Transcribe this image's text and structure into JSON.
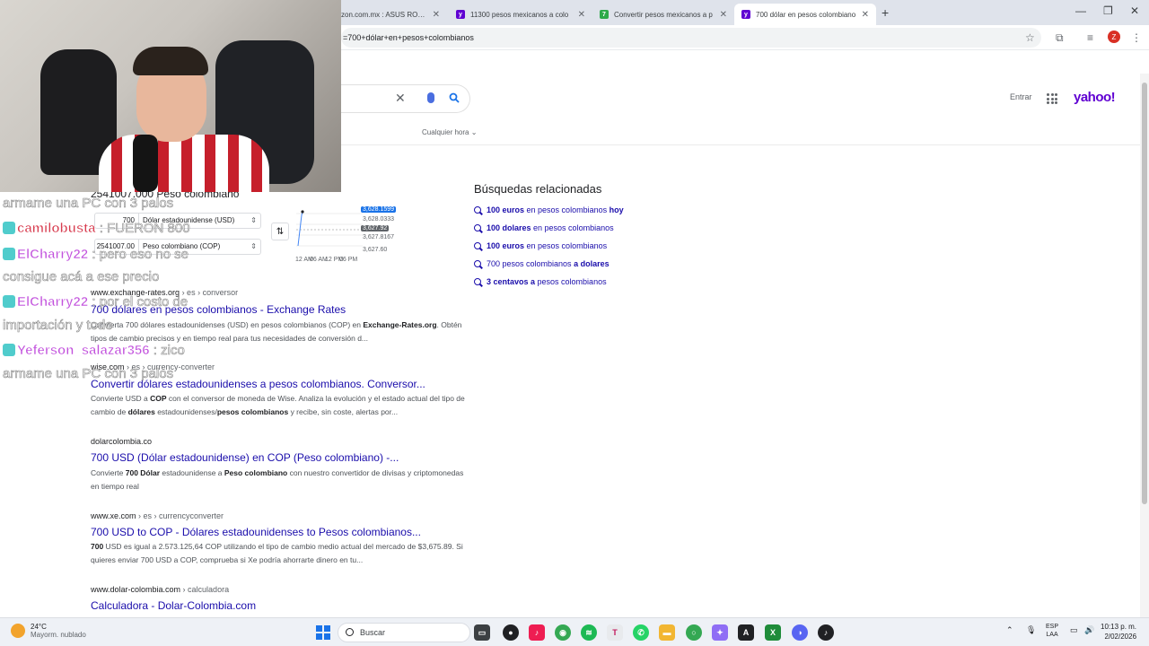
{
  "browser": {
    "tabs": [
      {
        "title": "zon.com.mx : ASUS ROG St",
        "favicon": "amazon-icon"
      },
      {
        "title": "11300 pesos mexicanos a colo",
        "favicon": "yahoo-icon"
      },
      {
        "title": "Convertir pesos mexicanos a p",
        "favicon": "green-icon"
      },
      {
        "title": "700 dólar en pesos colombiano",
        "favicon": "yahoo-icon"
      }
    ],
    "new_tab": "+",
    "address": "=700+dólar+en+pesos+colombianos",
    "profile_initial": "Z"
  },
  "page": {
    "entrar": "Entrar",
    "logo": "yahoo!",
    "filter": "Cualquier hora",
    "converter": {
      "result_title": "2541007.000 Peso colombiano",
      "from_amount": "700",
      "from_currency": "Dólar estadounidense (USD)",
      "to_amount": "2541007.00",
      "to_currency": "Peso colombiano (COP)",
      "chart_labels": [
        "3,628.1599",
        "3,628.0333",
        "3,627.92",
        "3,627.8167",
        "3,627.60"
      ],
      "x_labels": [
        "12 AM",
        "06 AM",
        "12 PM",
        "06 PM"
      ]
    },
    "results": [
      {
        "domain": "www.exchange-rates.org",
        "crumb": " › es › conversor",
        "title": "700 dólares en pesos colombianos - Exchange Rates",
        "snippet_parts": [
          {
            "t": "Convierta 700 dólares estadounidenses (USD) en pesos colombianos (COP) en ",
            "b": false
          },
          {
            "t": "Exchange-Rates.org",
            "b": true
          },
          {
            "t": ". Obtén tipos de cambio precisos y en tiempo real para tus necesidades de conversión d...",
            "b": false
          }
        ]
      },
      {
        "domain": "wise.com",
        "crumb": " › es › currency-converter",
        "title": "Convertir dólares estadounidenses a pesos colombianos. Conversor...",
        "snippet_parts": [
          {
            "t": "Convierte USD a ",
            "b": false
          },
          {
            "t": "COP",
            "b": true
          },
          {
            "t": " con el conversor de moneda de Wise. Analiza la evolución y el estado actual del tipo de cambio de ",
            "b": false
          },
          {
            "t": "dólares",
            "b": true
          },
          {
            "t": " estadounidenses/",
            "b": false
          },
          {
            "t": "pesos colombianos",
            "b": true
          },
          {
            "t": " y recibe, sin coste, alertas por...",
            "b": false
          }
        ]
      },
      {
        "domain": "dolarcolombia.co",
        "crumb": "",
        "title": "700 USD (Dólar estadounidense) en COP (Peso colombiano) -...",
        "snippet_parts": [
          {
            "t": "Convierte ",
            "b": false
          },
          {
            "t": "700 Dólar",
            "b": true
          },
          {
            "t": " estadounidense a ",
            "b": false
          },
          {
            "t": "Peso colombiano",
            "b": true
          },
          {
            "t": " con nuestro convertidor de divisas y criptomonedas en tiempo real",
            "b": false
          }
        ]
      },
      {
        "domain": "www.xe.com",
        "crumb": " › es › currencyconverter",
        "title": "700 USD to COP - Dólares estadounidenses to Pesos colombianos...",
        "snippet_parts": [
          {
            "t": "700",
            "b": true
          },
          {
            "t": " USD es igual a 2.573.125,64 COP utilizando el tipo de cambio medio actual del mercado de $3,675.89. Si quieres enviar 700 USD a COP, comprueba si Xe podría ahorrarte dinero en tu...",
            "b": false
          }
        ]
      },
      {
        "domain": "www.dolar-colombia.com",
        "crumb": " › calculadora",
        "title": "Calculadora - Dolar-Colombia.com",
        "snippet_parts": []
      }
    ],
    "related": {
      "heading": "Búsquedas relacionadas",
      "items": [
        {
          "pre": "100 euros",
          "mid": " en pesos colombianos ",
          "post": "hoy"
        },
        {
          "pre": "100 dolares",
          "mid": " en pesos colombianos",
          "post": ""
        },
        {
          "pre": "100 euros",
          "mid": " en pesos colombianos",
          "post": ""
        },
        {
          "pre": "",
          "mid": "700 pesos colombianos ",
          "post": "a dolares"
        },
        {
          "pre": "3 centavos a",
          "mid": " pesos colombianos",
          "post": ""
        }
      ]
    }
  },
  "chat": [
    {
      "user": "",
      "msg": "armame una PC con 3 palos",
      "color": "#ffffff"
    },
    {
      "user": "camilobusta",
      "msg": ": FUERON 800",
      "color": "#d0132a"
    },
    {
      "user": "ElCharry22",
      "msg": ": pero eso no se",
      "color": "#b52bd6"
    },
    {
      "user": "",
      "msg": "consigue acá a ese precio",
      "color": "#ffffff"
    },
    {
      "user": "ElCharry22",
      "msg": ": por el costo de",
      "color": "#b52bd6"
    },
    {
      "user": "",
      "msg": "importación y todo",
      "color": "#ffffff"
    },
    {
      "user": "Yeferson_salazar356",
      "msg": ": zico",
      "color": "#b52bd6"
    },
    {
      "user": "",
      "msg": "armame una PC con 3 palos",
      "color": "#ffffff"
    }
  ],
  "taskbar": {
    "temp": "24°C",
    "weather": "Mayorm. nublado",
    "search": "Buscar",
    "lang1": "ESP",
    "lang2": "LAA",
    "time": "10:13 p. m.",
    "date": "2/02/2026"
  }
}
